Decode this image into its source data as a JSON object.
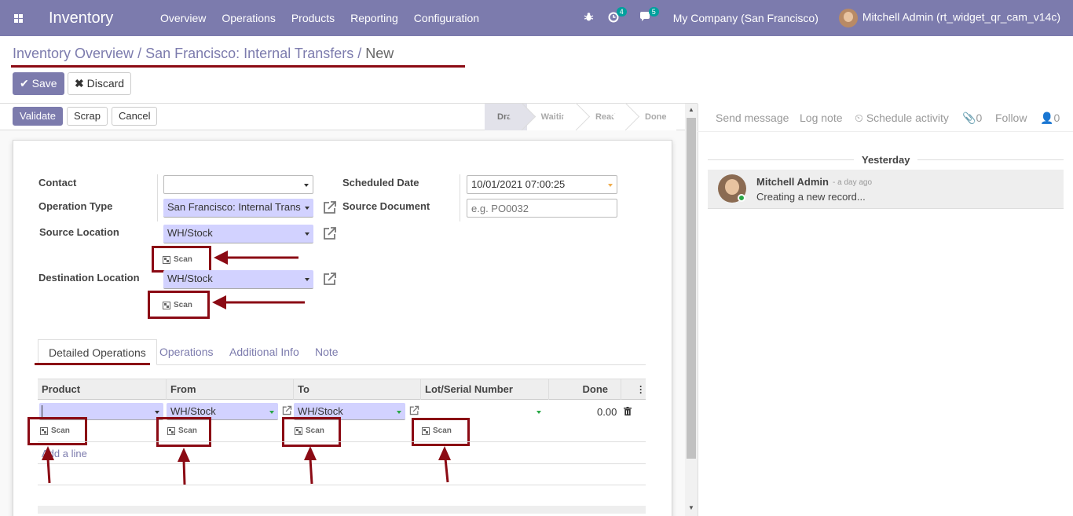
{
  "navbar": {
    "app_title": "Inventory",
    "menu": [
      "Overview",
      "Operations",
      "Products",
      "Reporting",
      "Configuration"
    ],
    "activity_count": "4",
    "message_count": "5",
    "company": "My Company (San Francisco)",
    "user": "Mitchell Admin (rt_widget_qr_cam_v14c)"
  },
  "breadcrumb": {
    "items": [
      "Inventory Overview",
      "San Francisco: Internal Transfers"
    ],
    "current": "New",
    "separator": "/"
  },
  "control": {
    "save_label": "Save",
    "discard_label": "Discard"
  },
  "statusbar": {
    "validate_label": "Validate",
    "scrap_label": "Scrap",
    "cancel_label": "Cancel",
    "stages": [
      "Draft",
      "Waiting",
      "Ready",
      "Done"
    ],
    "active_stage": "Draft"
  },
  "form": {
    "contact_label": "Contact",
    "contact_value": "",
    "operation_type_label": "Operation Type",
    "operation_type_value": "San Francisco: Internal Trans",
    "source_location_label": "Source Location",
    "source_location_value": "WH/Stock",
    "destination_location_label": "Destination Location",
    "destination_location_value": "WH/Stock",
    "scheduled_date_label": "Scheduled Date",
    "scheduled_date_value": "10/01/2021 07:00:25",
    "source_document_label": "Source Document",
    "source_document_placeholder": "e.g. PO0032",
    "scan_label": "Scan"
  },
  "tabs": [
    "Detailed Operations",
    "Operations",
    "Additional Info",
    "Note"
  ],
  "active_tab": "Detailed Operations",
  "table": {
    "columns": [
      "Product",
      "From",
      "To",
      "Lot/Serial Number",
      "Done"
    ],
    "row": {
      "product": "",
      "from": "WH/Stock",
      "to": "WH/Stock",
      "lot": "",
      "done": "0.00"
    },
    "add_line": "Add a line"
  },
  "chatter": {
    "send_message": "Send message",
    "log_note": "Log note",
    "schedule_activity": "Schedule activity",
    "attachments_count": "0",
    "follow_label": "Follow",
    "followers_count": "0",
    "date_separator": "Yesterday",
    "message": {
      "author": "Mitchell Admin",
      "date": "- a day ago",
      "body": "Creating a new record..."
    }
  },
  "colors": {
    "brand": "#7c7bad",
    "annotation": "#8b0a14",
    "required_field": "#d2d2ff",
    "badge": "#00a09d"
  }
}
